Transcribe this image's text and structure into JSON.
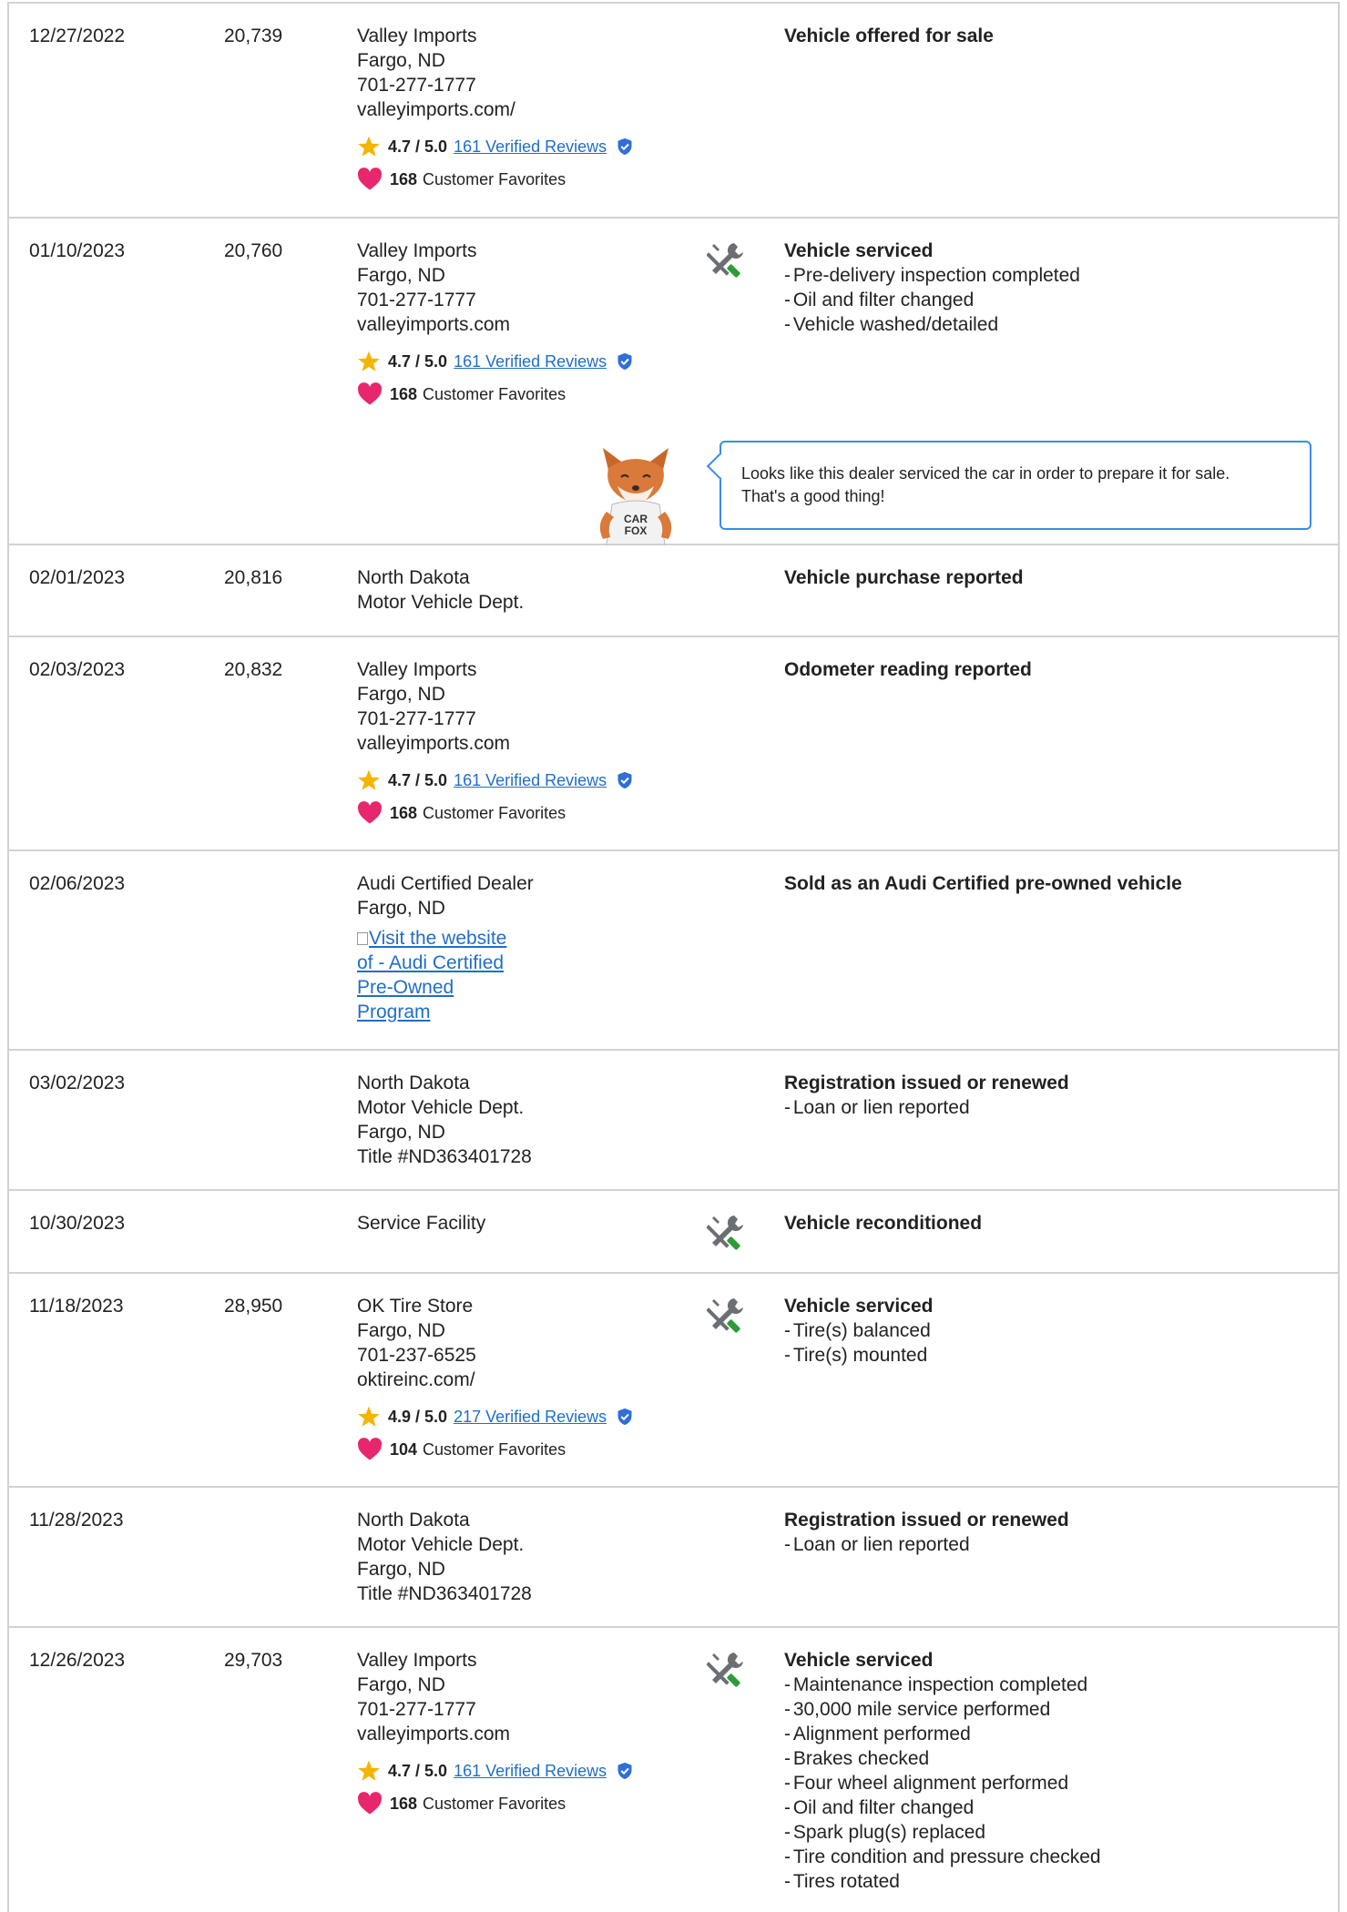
{
  "records": [
    {
      "date": "12/27/2022",
      "odometer": "20,739",
      "source": [
        "Valley Imports",
        "Fargo, ND",
        "701-277-1777",
        "valleyimports.com/"
      ],
      "rating": {
        "score": "4.7 / 5.0",
        "reviews": "161 Verified Reviews"
      },
      "favorites": {
        "count": "168",
        "label": "Customer Favorites"
      },
      "title": "Vehicle offered for sale",
      "items": []
    },
    {
      "date": "01/10/2023",
      "odometer": "20,760",
      "source": [
        "Valley Imports",
        "Fargo, ND",
        "701-277-1777",
        "valleyimports.com"
      ],
      "rating": {
        "score": "4.7 / 5.0",
        "reviews": "161 Verified Reviews"
      },
      "favorites": {
        "count": "168",
        "label": "Customer Favorites"
      },
      "icon": "wrench-screwdriver-icon",
      "title": "Vehicle serviced",
      "items": [
        "Pre-delivery inspection completed",
        "Oil and filter changed",
        "Vehicle washed/detailed"
      ],
      "tip": {
        "line1": "Looks like this dealer serviced the car in order to prepare it for sale.",
        "line2": "That's a good thing!"
      },
      "mascot": {
        "shirt_line1": "CAR",
        "shirt_line2": "FOX"
      }
    },
    {
      "date": "02/01/2023",
      "odometer": "20,816",
      "source": [
        "North Dakota",
        "Motor Vehicle Dept."
      ],
      "title": "Vehicle purchase reported",
      "items": []
    },
    {
      "date": "02/03/2023",
      "odometer": "20,832",
      "source": [
        "Valley Imports",
        "Fargo, ND",
        "701-277-1777",
        "valleyimports.com"
      ],
      "rating": {
        "score": "4.7 / 5.0",
        "reviews": "161 Verified Reviews"
      },
      "favorites": {
        "count": "168",
        "label": "Customer Favorites"
      },
      "title": "Odometer reading reported",
      "items": []
    },
    {
      "date": "02/06/2023",
      "odometer": "",
      "source": [
        "Audi Certified Dealer",
        "Fargo, ND"
      ],
      "link": "Visit the website of - Audi Certified Pre-Owned Program",
      "title": "Sold as an Audi Certified pre-owned vehicle",
      "items": []
    },
    {
      "date": "03/02/2023",
      "odometer": "",
      "source": [
        "North Dakota",
        "Motor Vehicle Dept.",
        "Fargo, ND",
        "Title #ND363401728"
      ],
      "title": "Registration issued or renewed",
      "items": [
        "Loan or lien reported"
      ]
    },
    {
      "date": "10/30/2023",
      "odometer": "",
      "source": [
        "Service Facility"
      ],
      "icon": "wrench-screwdriver-icon",
      "title": "Vehicle reconditioned",
      "items": []
    },
    {
      "date": "11/18/2023",
      "odometer": "28,950",
      "source": [
        "OK Tire Store",
        "Fargo, ND",
        "701-237-6525",
        "oktireinc.com/"
      ],
      "rating": {
        "score": "4.9 / 5.0",
        "reviews": "217 Verified Reviews"
      },
      "favorites": {
        "count": "104",
        "label": "Customer Favorites"
      },
      "icon": "wrench-screwdriver-icon",
      "title": "Vehicle serviced",
      "items": [
        "Tire(s) balanced",
        "Tire(s) mounted"
      ]
    },
    {
      "date": "11/28/2023",
      "odometer": "",
      "source": [
        "North Dakota",
        "Motor Vehicle Dept.",
        "Fargo, ND",
        "Title #ND363401728"
      ],
      "title": "Registration issued or renewed",
      "items": [
        "Loan or lien reported"
      ]
    },
    {
      "date": "12/26/2023",
      "odometer": "29,703",
      "source": [
        "Valley Imports",
        "Fargo, ND",
        "701-277-1777",
        "valleyimports.com"
      ],
      "rating": {
        "score": "4.7 / 5.0",
        "reviews": "161 Verified Reviews"
      },
      "favorites": {
        "count": "168",
        "label": "Customer Favorites"
      },
      "icon": "wrench-screwdriver-icon",
      "title": "Vehicle serviced",
      "items": [
        "Maintenance inspection completed",
        "30,000 mile service performed",
        "Alignment performed",
        "Brakes checked",
        "Four wheel alignment performed",
        "Oil and filter changed",
        "Spark plug(s) replaced",
        "Tire condition and pressure checked",
        "Tires rotated"
      ]
    }
  ],
  "colors": {
    "link": "#1f6ec9",
    "star": "#f5b400",
    "heart": "#e8266d",
    "verified": "#2f6fd6",
    "tool_green": "#2e9b3a",
    "tool_gray": "#6b6f73",
    "border": "#cfd3d6",
    "bubble_border": "#3a8de0"
  }
}
